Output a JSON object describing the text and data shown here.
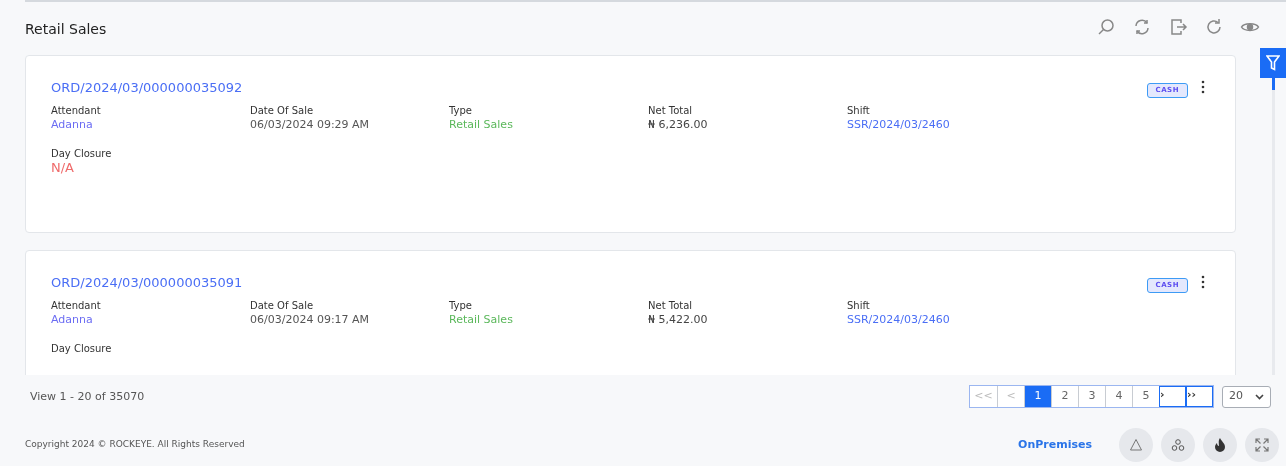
{
  "page": {
    "title": "Retail Sales"
  },
  "records": [
    {
      "order_no": "ORD/2024/03/000000035092",
      "badge": "CASH",
      "fields": [
        {
          "label": "Attendant",
          "value": "Adanna",
          "kind": "person"
        },
        {
          "label": "Date Of Sale",
          "value": "06/03/2024 09:29 AM",
          "kind": "text"
        },
        {
          "label": "Type",
          "value": "Retail Sales",
          "kind": "type"
        },
        {
          "label": "Net Total",
          "value": "₦ 6,236.00",
          "kind": "amount"
        },
        {
          "label": "Shift",
          "value": "SSR/2024/03/2460",
          "kind": "link"
        },
        {
          "label": "Day Closure",
          "value": "N/A",
          "kind": "missing"
        }
      ]
    },
    {
      "order_no": "ORD/2024/03/000000035091",
      "badge": "CASH",
      "fields": [
        {
          "label": "Attendant",
          "value": "Adanna",
          "kind": "person"
        },
        {
          "label": "Date Of Sale",
          "value": "06/03/2024 09:17 AM",
          "kind": "text"
        },
        {
          "label": "Type",
          "value": "Retail Sales",
          "kind": "type"
        },
        {
          "label": "Net Total",
          "value": "₦ 5,422.00",
          "kind": "amount"
        },
        {
          "label": "Shift",
          "value": "SSR/2024/03/2460",
          "kind": "link"
        },
        {
          "label": "Day Closure",
          "kind": "missing"
        }
      ]
    }
  ],
  "summary": "View 1 - 20 of 35070",
  "pagination": [
    {
      "label": "<<",
      "kind": "first",
      "disabled": true,
      "selected": false
    },
    {
      "label": "<",
      "kind": "prev",
      "disabled": true,
      "selected": false
    },
    {
      "label": "1",
      "kind": "page",
      "disabled": false,
      "selected": true
    },
    {
      "label": "2",
      "kind": "page",
      "disabled": false,
      "selected": false
    },
    {
      "label": "3",
      "kind": "page",
      "disabled": false,
      "selected": false
    },
    {
      "label": "4",
      "kind": "page",
      "disabled": false,
      "selected": false
    },
    {
      "label": "5",
      "kind": "page",
      "disabled": false,
      "selected": false
    },
    {
      "label": "›",
      "kind": "next",
      "disabled": false,
      "selected": false
    },
    {
      "label": "››",
      "kind": "last",
      "disabled": false,
      "selected": false
    }
  ],
  "page_size": "20",
  "footer": {
    "copyright": "Copyright 2024 © ROCKEYE. All Rights Reserved",
    "mode": "OnPremises"
  }
}
